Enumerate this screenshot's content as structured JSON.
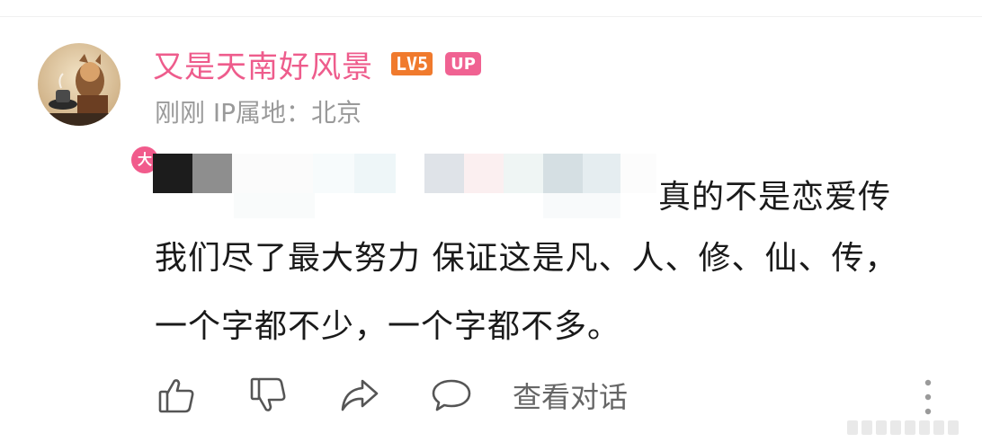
{
  "comment": {
    "author": {
      "name": "又是天南好风景",
      "level": "LV5",
      "up_badge": "UP",
      "avatar_badge": "大"
    },
    "meta": "刚刚 IP属地：北京",
    "text_line1": "真的不是恋爱传",
    "text_line2": "我们尽了最大努力 保证这是凡、人、修、仙、传，",
    "text_line3": "一个字都不少，一个字都不多。"
  },
  "actions": {
    "like": "thumbs-up-icon",
    "dislike": "thumbs-down-icon",
    "share": "share-icon",
    "reply": "comment-icon",
    "view_conversation": "查看对话",
    "more": "more-vertical-icon"
  },
  "colors": {
    "username": "#ee5c8c",
    "level_badge": "#f07a2d",
    "up_badge": "#f06292",
    "meta": "#9a9a9a",
    "text": "#1a1a1a"
  }
}
